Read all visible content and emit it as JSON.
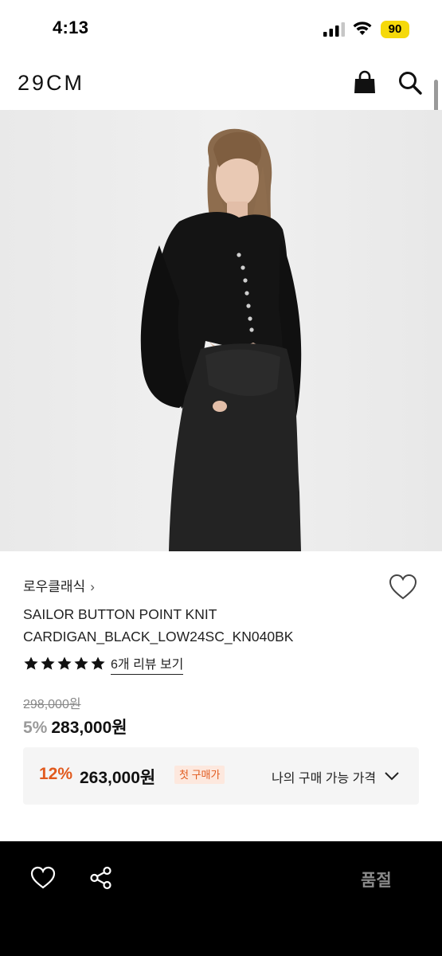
{
  "status": {
    "time": "4:13",
    "battery": "90",
    "battery_color": "#f5d90a"
  },
  "header": {
    "logo": "29CM",
    "bag_icon": "shopping-bag-icon",
    "search_icon": "search-icon"
  },
  "hero": {
    "alt": "model wearing black sailor button point knit cardigan and black skirt"
  },
  "product": {
    "brand": "로우클래식",
    "brand_chevron": "›",
    "name": "SAILOR BUTTON POINT KNIT CARDIGAN_BLACK_LOW24SC_KN040BK",
    "rating_stars": 5,
    "review_link": "6개 리뷰 보기",
    "original_price": "298,000원",
    "sale_rate": "5%",
    "sale_price": "283,000원"
  },
  "coupon": {
    "rate": "12%",
    "price": "263,000원",
    "badge": "첫 구매가",
    "my_price_label": "나의 구매 가능 가격",
    "accent_color": "#e15a1e"
  },
  "bottom_bar": {
    "like_icon": "heart-icon",
    "share_icon": "share-icon",
    "status_label": "품절"
  }
}
